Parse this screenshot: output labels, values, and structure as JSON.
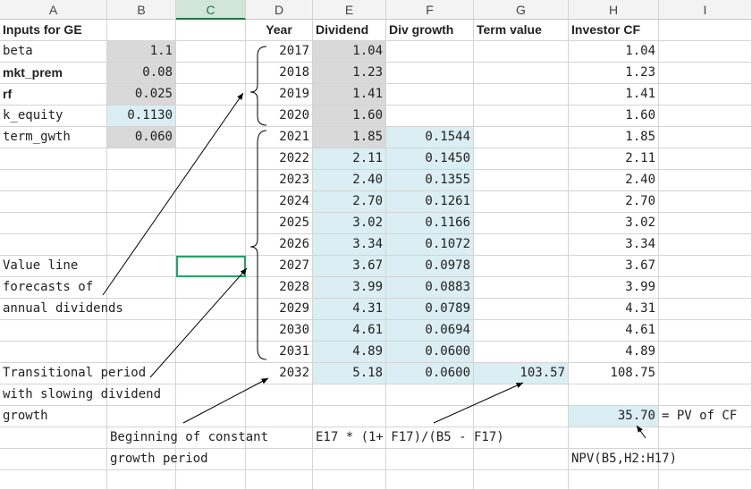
{
  "columns": [
    "A",
    "B",
    "C",
    "D",
    "E",
    "F",
    "G",
    "H",
    "I"
  ],
  "selected_column": "C",
  "inputs": {
    "title": "Inputs for GE",
    "beta_label": "beta",
    "beta_value": "1.1",
    "mkt_label": "mkt_prem",
    "mkt_value": "0.08",
    "rf_label": "rf",
    "rf_value": "0.025",
    "kequity_label": "k_equity",
    "kequity_value": "0.1130",
    "term_label": "term_gwth",
    "term_value": "0.060"
  },
  "headers": {
    "year": "Year",
    "dividend": "Dividend",
    "div_growth": "Div growth",
    "term_value": "Term value",
    "investor_cf": "Investor CF"
  },
  "rows": [
    {
      "year": "2017",
      "dividend": "1.04",
      "growth": "",
      "term": "",
      "cf": "1.04"
    },
    {
      "year": "2018",
      "dividend": "1.23",
      "growth": "",
      "term": "",
      "cf": "1.23"
    },
    {
      "year": "2019",
      "dividend": "1.41",
      "growth": "",
      "term": "",
      "cf": "1.41"
    },
    {
      "year": "2020",
      "dividend": "1.60",
      "growth": "",
      "term": "",
      "cf": "1.60"
    },
    {
      "year": "2021",
      "dividend": "1.85",
      "growth": "0.1544",
      "term": "",
      "cf": "1.85"
    },
    {
      "year": "2022",
      "dividend": "2.11",
      "growth": "0.1450",
      "term": "",
      "cf": "2.11"
    },
    {
      "year": "2023",
      "dividend": "2.40",
      "growth": "0.1355",
      "term": "",
      "cf": "2.40"
    },
    {
      "year": "2024",
      "dividend": "2.70",
      "growth": "0.1261",
      "term": "",
      "cf": "2.70"
    },
    {
      "year": "2025",
      "dividend": "3.02",
      "growth": "0.1166",
      "term": "",
      "cf": "3.02"
    },
    {
      "year": "2026",
      "dividend": "3.34",
      "growth": "0.1072",
      "term": "",
      "cf": "3.34"
    },
    {
      "year": "2027",
      "dividend": "3.67",
      "growth": "0.0978",
      "term": "",
      "cf": "3.67"
    },
    {
      "year": "2028",
      "dividend": "3.99",
      "growth": "0.0883",
      "term": "",
      "cf": "3.99"
    },
    {
      "year": "2029",
      "dividend": "4.31",
      "growth": "0.0789",
      "term": "",
      "cf": "4.31"
    },
    {
      "year": "2030",
      "dividend": "4.61",
      "growth": "0.0694",
      "term": "",
      "cf": "4.61"
    },
    {
      "year": "2031",
      "dividend": "4.89",
      "growth": "0.0600",
      "term": "",
      "cf": "4.89"
    },
    {
      "year": "2032",
      "dividend": "5.18",
      "growth": "0.0600",
      "term": "103.57",
      "cf": "108.75"
    }
  ],
  "notes": {
    "value_line_1": "Value line",
    "value_line_2": "forecasts of",
    "value_line_3": "annual dividends",
    "transitional_1": "Transitional period",
    "transitional_2": "with slowing dividend",
    "transitional_3": "growth",
    "constant_1": "Beginning of constant",
    "constant_2": "growth period",
    "term_formula": "E17 * (1+ F17)/(B5 - F17)",
    "pv_value": "35.70",
    "pv_label": "= PV of CF",
    "npv_formula": "NPV(B5,H2:H17)"
  }
}
